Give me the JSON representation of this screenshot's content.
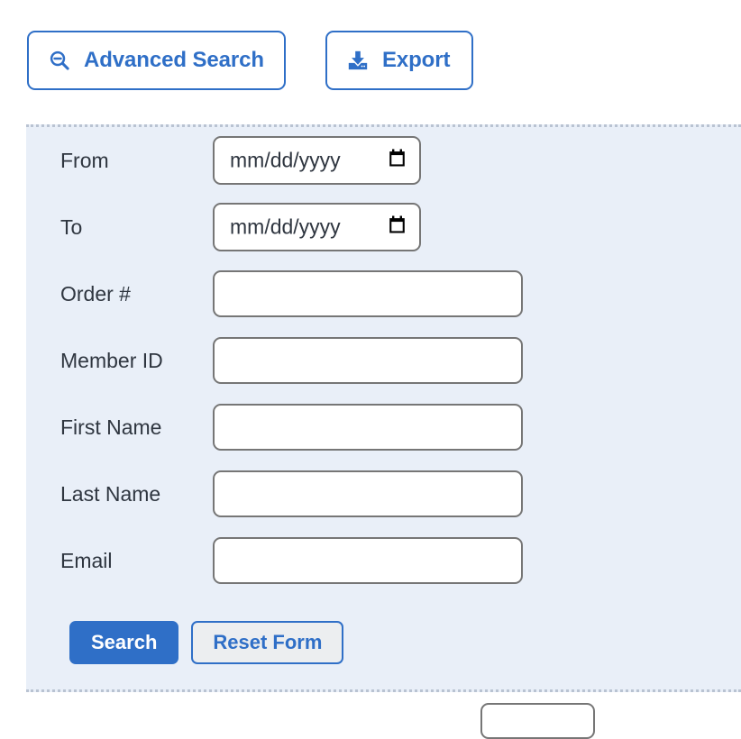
{
  "toolbar": {
    "advanced_search": {
      "label": "Advanced Search",
      "icon": "zoom-out-magnifier-icon"
    },
    "export": {
      "label": "Export",
      "icon": "download-tray-icon"
    }
  },
  "advanced_search_panel": {
    "fields": [
      {
        "label": "From",
        "type": "date",
        "value": "",
        "placeholder": "mm/dd/yyyy"
      },
      {
        "label": "To",
        "type": "date",
        "value": "",
        "placeholder": "mm/dd/yyyy"
      },
      {
        "label": "Order #",
        "type": "text",
        "value": "",
        "placeholder": ""
      },
      {
        "label": "Member ID",
        "type": "text",
        "value": "",
        "placeholder": ""
      },
      {
        "label": "First Name",
        "type": "text",
        "value": "",
        "placeholder": ""
      },
      {
        "label": "Last Name",
        "type": "text",
        "value": "",
        "placeholder": ""
      },
      {
        "label": "Email",
        "type": "text",
        "value": "",
        "placeholder": ""
      }
    ],
    "actions": {
      "search_label": "Search",
      "reset_label": "Reset Form"
    }
  },
  "colors": {
    "accent_blue": "#2f6fc7",
    "panel_background": "#e9eff8",
    "panel_dotted_border": "#b9c3d2",
    "input_border": "#767676",
    "label_text": "#2f3640",
    "secondary_button_background": "#eceef0",
    "page_background": "#ffffff"
  }
}
